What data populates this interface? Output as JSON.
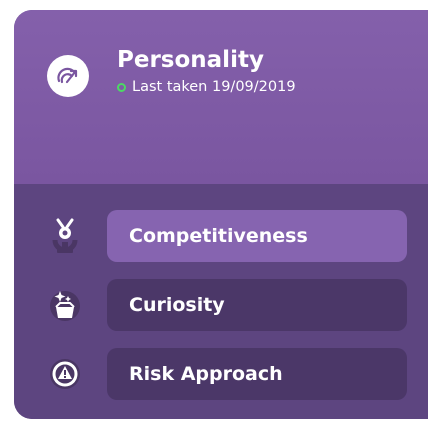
{
  "card": {
    "title": "Personality",
    "status_text": "Last taken 19/09/2019",
    "status_color": "#4cd964",
    "avatar_icon": "speedometer-icon",
    "header_color": "#8460ab",
    "list_color": "#5d4580"
  },
  "items": [
    {
      "label": "Competitiveness",
      "icon": "medal-icon",
      "active": true
    },
    {
      "label": "Curiosity",
      "icon": "sparkle-box-icon",
      "active": false
    },
    {
      "label": "Risk Approach",
      "icon": "warning-icon",
      "active": false
    }
  ],
  "colors": {
    "active_pill": "#8664b0",
    "inactive_pill": "#4b3768"
  }
}
